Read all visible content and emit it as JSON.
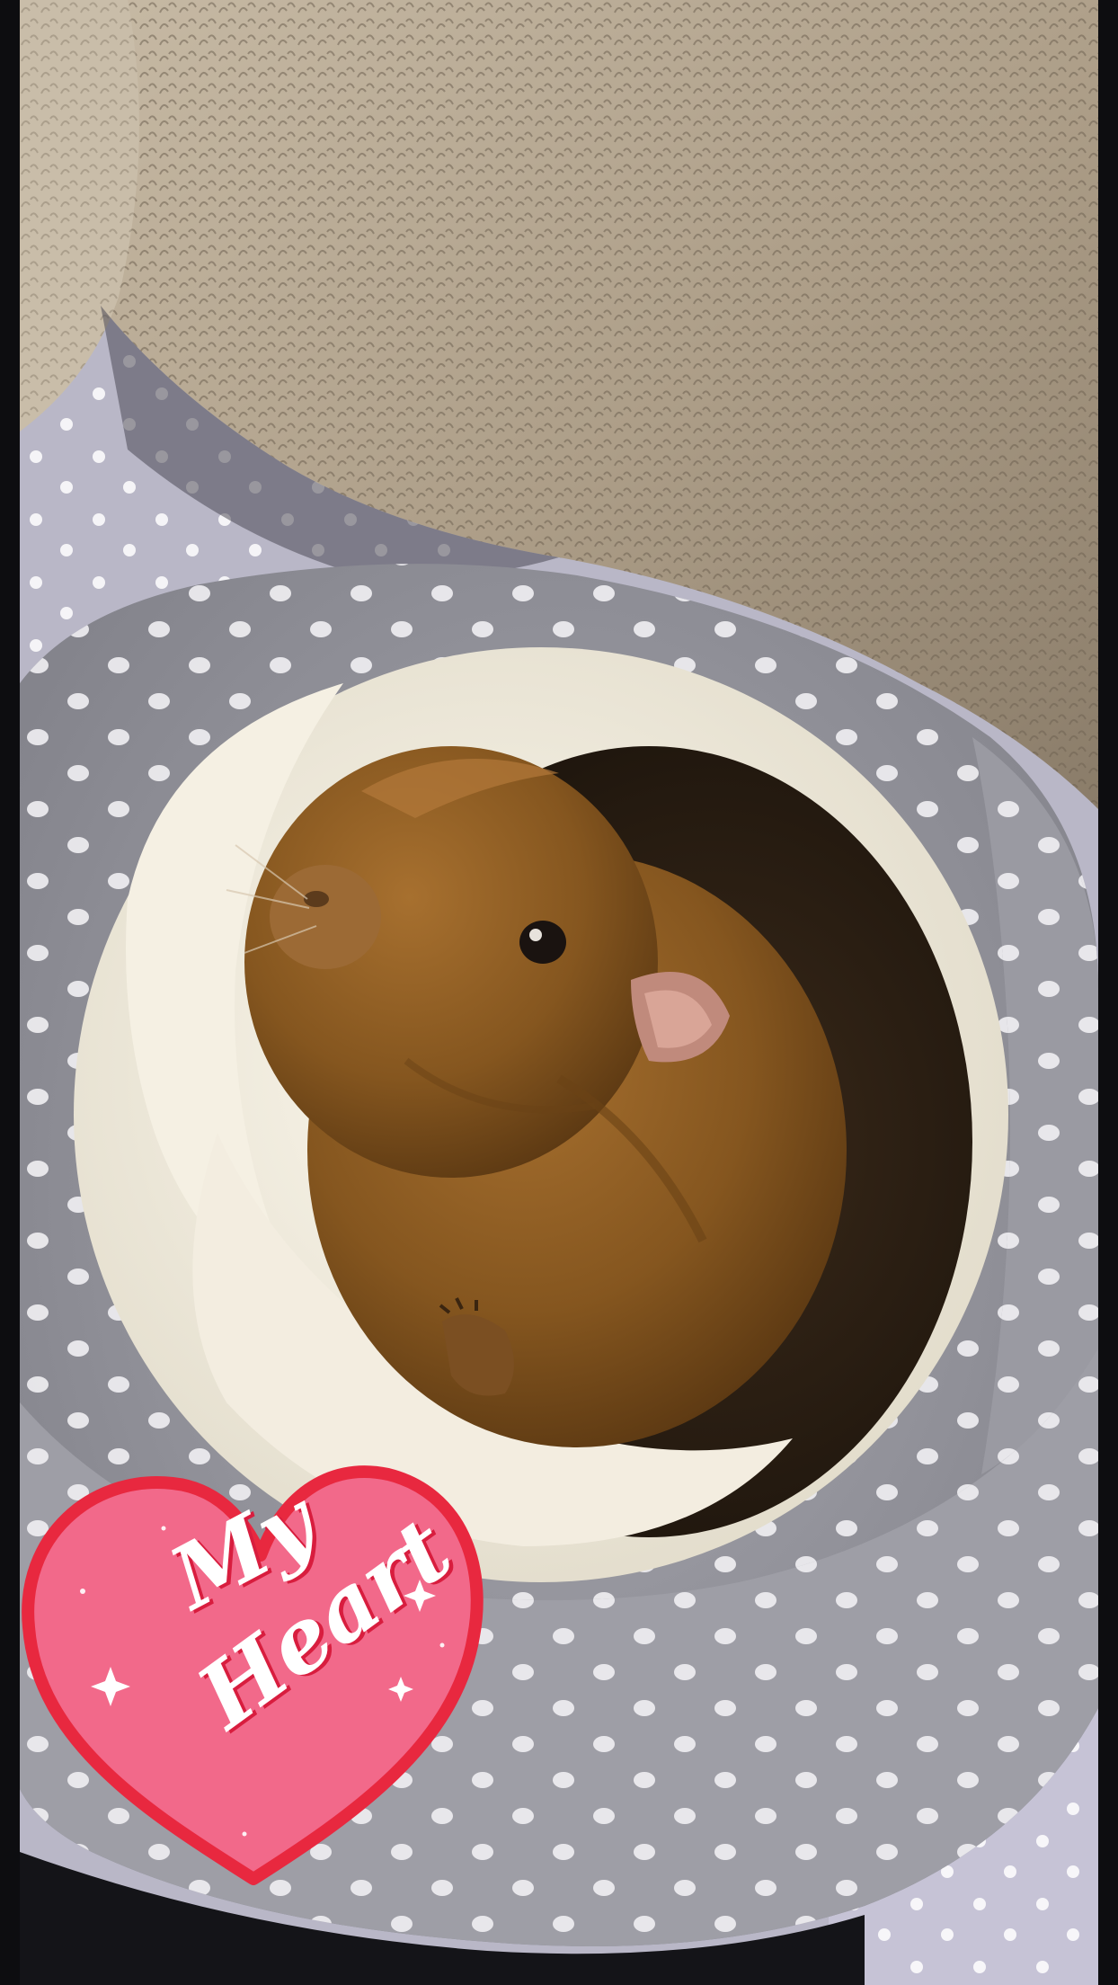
{
  "sticker": {
    "line1": "My",
    "line2": "Heart"
  },
  "colors": {
    "blanket": "#b8a994",
    "bed_outer": "#9a9aa2",
    "bed_lining": "#f4efe2",
    "guinea_pig": "#8a5a25",
    "heart_fill": "#f2698a",
    "heart_outline": "#e8283f"
  },
  "icons": [
    "sparkle-icon"
  ]
}
